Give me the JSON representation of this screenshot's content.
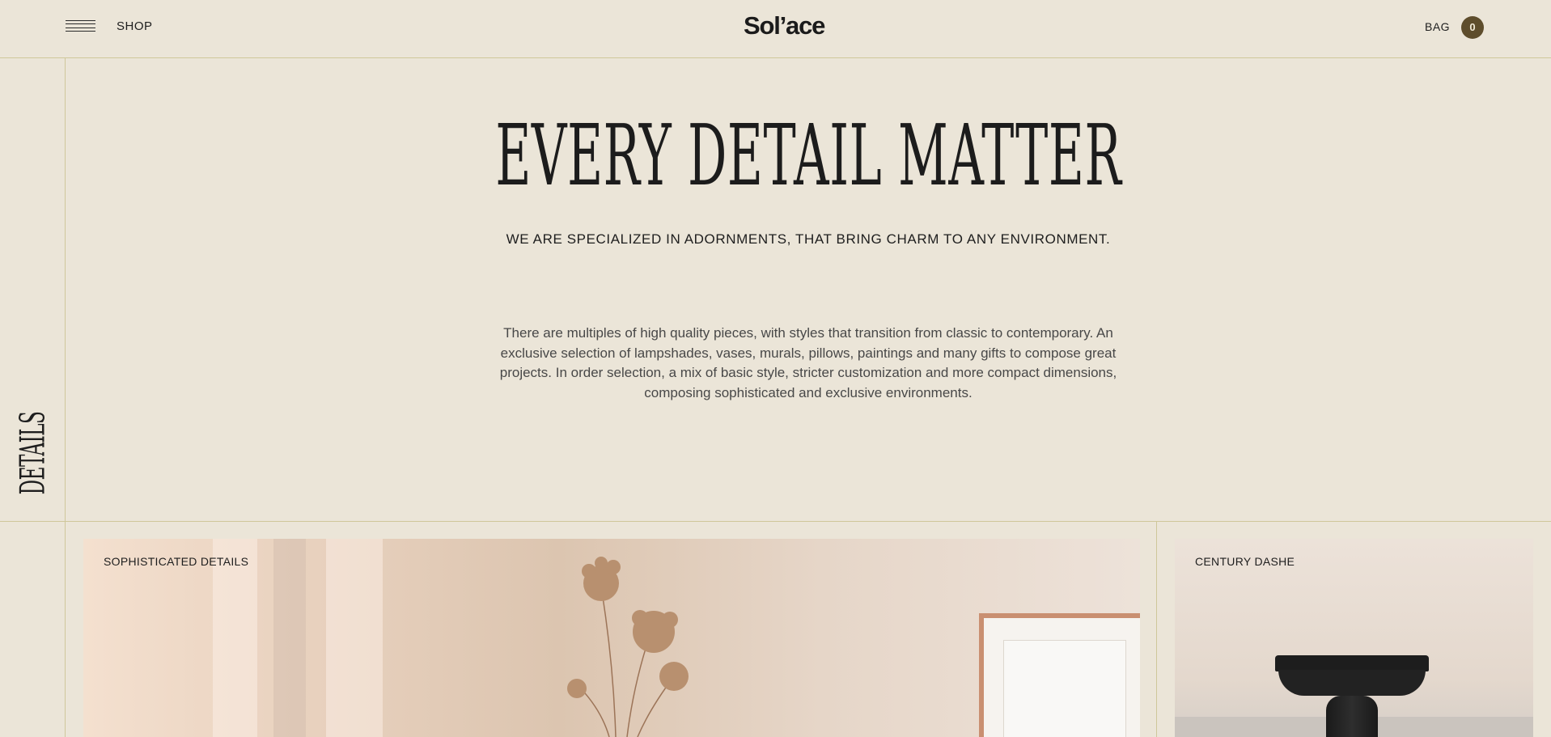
{
  "header": {
    "menu_label": "",
    "shop_label": "SHOP",
    "logo": "Sol’ace",
    "bag_label": "BAG",
    "bag_count": "0"
  },
  "side": {
    "label": "DETAILS"
  },
  "hero": {
    "title": "EVERY DETAIL MATTER",
    "subtitle": "WE ARE SPECIALIZED IN ADORNMENTS, THAT BRING CHARM TO ANY ENVIRONMENT.",
    "body": "There are multiples of high quality pieces, with styles that transition from classic to contemporary. An exclusive selection of lampshades, vases, murals, pillows, paintings and many gifts to compose great projects. In order selection, a mix of basic style, stricter customization and more compact dimensions, composing sophisticated and exclusive environments."
  },
  "cards": [
    {
      "label": "SOPHISTICATED DETAILS",
      "image": "dried-flowers-and-frame-photo"
    },
    {
      "label": "CENTURY DASHE",
      "image": "black-pedestal-bowl-photo"
    }
  ],
  "colors": {
    "background": "#ebe5d8",
    "rule": "#cfc79a",
    "bag_badge": "#5e4d2c",
    "text": "#1e1e1e"
  }
}
